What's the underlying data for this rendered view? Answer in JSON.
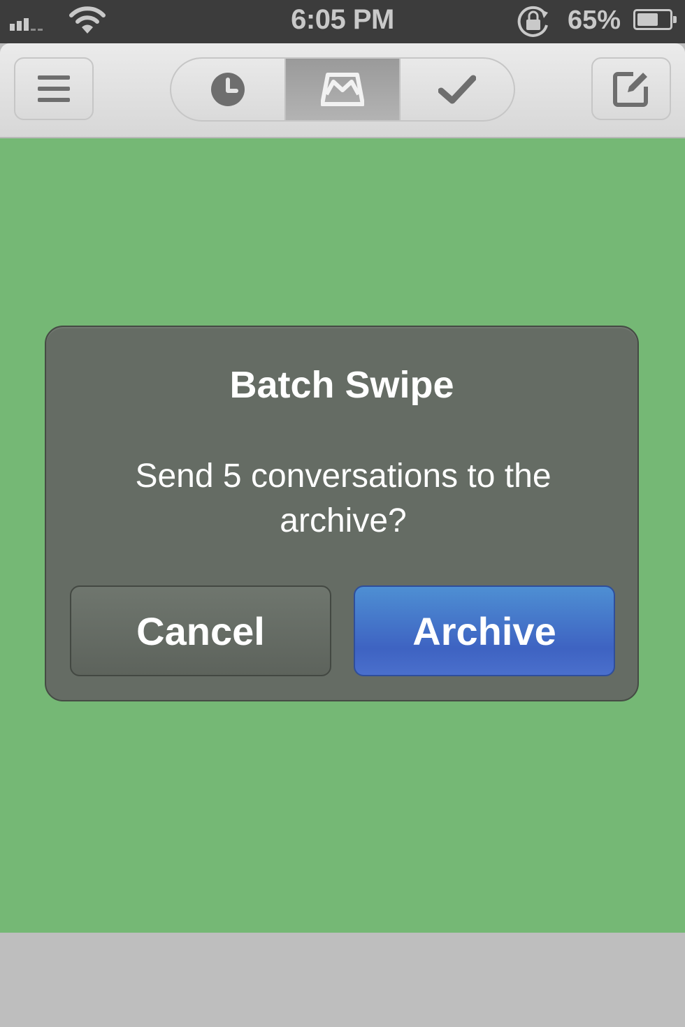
{
  "status_bar": {
    "time": "6:05 PM",
    "battery_percent_label": "65%",
    "battery_level": 0.65,
    "icons": [
      "signal-icon",
      "wifi-icon",
      "rotation-lock-icon",
      "battery-icon"
    ]
  },
  "navbar": {
    "left_icon": "menu-icon",
    "right_icon": "compose-icon",
    "segments": [
      {
        "icon": "clock-icon",
        "active": false
      },
      {
        "icon": "inbox-tray-icon",
        "active": true
      },
      {
        "icon": "checkmark-icon",
        "active": false
      }
    ]
  },
  "colors": {
    "list_background": "#75b875",
    "dialog_background": "#656c64",
    "archive_button": "#3e63c2"
  },
  "dialog": {
    "title": "Batch Swipe",
    "message": "Send 5 conversations to the archive?",
    "cancel_label": "Cancel",
    "confirm_label": "Archive"
  }
}
